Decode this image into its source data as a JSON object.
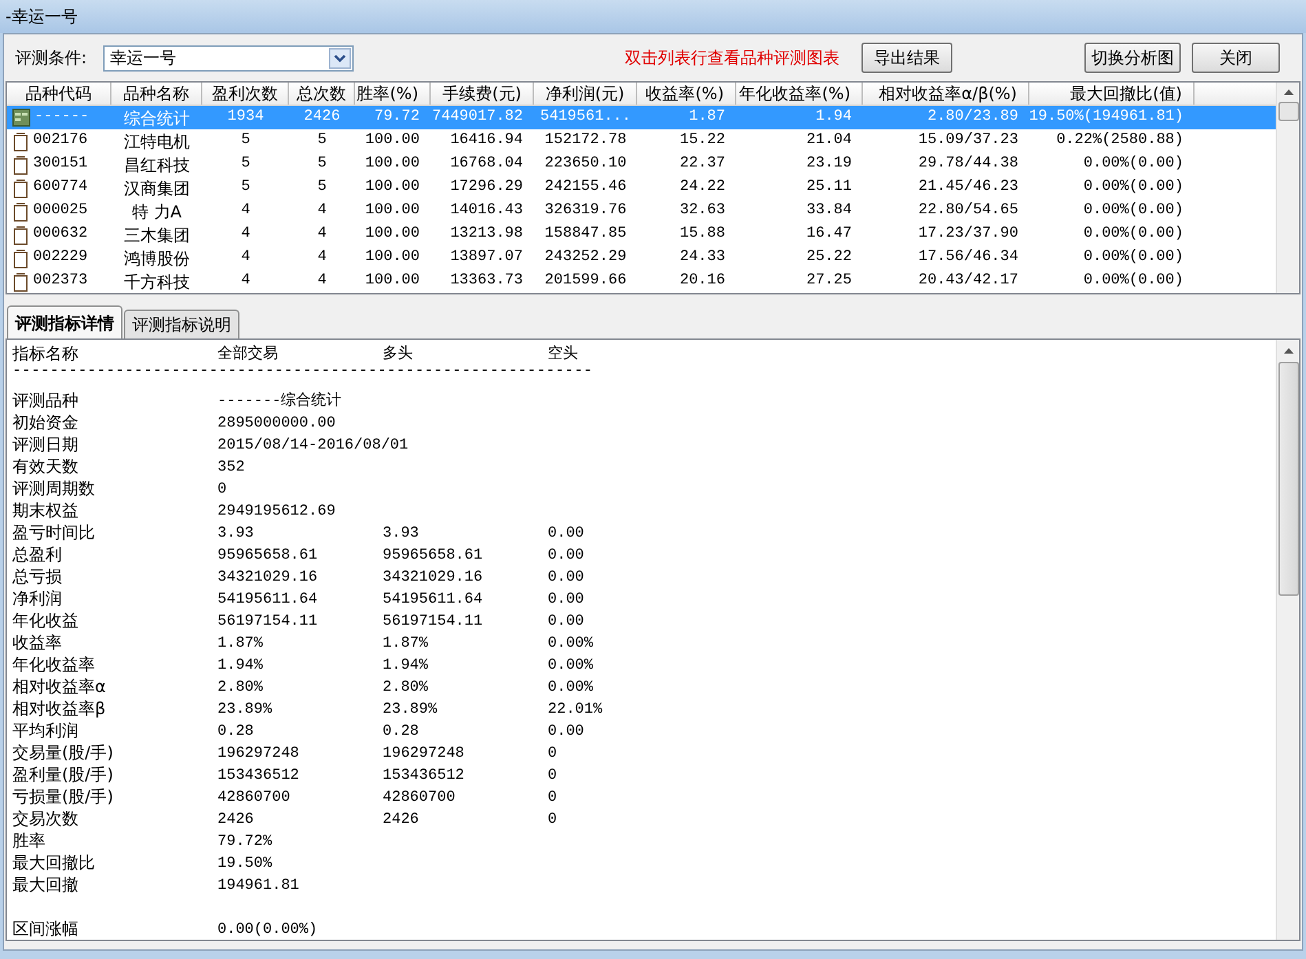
{
  "window": {
    "title": "-幸运一号"
  },
  "toolbar": {
    "condition_label": "评测条件:",
    "condition_value": "幸运一号",
    "hint": "双击列表行查看品种评测图表",
    "buttons": [
      "导出结果",
      "切换分析图",
      "关闭"
    ]
  },
  "table": {
    "columns": [
      "品种代码",
      "品种名称",
      "盈利次数",
      "总次数",
      "胜率(%)",
      "手续费(元)",
      "净利润(元)",
      "收益率(%)",
      "年化收益率(%)",
      "相对收益率α/β(%)",
      "最大回撤比(值)"
    ],
    "rows": [
      {
        "kind": "summary",
        "selected": true,
        "cells": [
          "------",
          "综合统计",
          "1934",
          "2426",
          "79.72",
          "7449017.82",
          "5419561...",
          "1.87",
          "1.94",
          "2.80/23.89",
          "19.50%(194961.81)"
        ]
      },
      {
        "kind": "stock",
        "selected": false,
        "cells": [
          "002176",
          "江特电机",
          "5",
          "5",
          "100.00",
          "16416.94",
          "152172.78",
          "15.22",
          "21.04",
          "15.09/37.23",
          "0.22%(2580.88)"
        ]
      },
      {
        "kind": "stock",
        "selected": false,
        "cells": [
          "300151",
          "昌红科技",
          "5",
          "5",
          "100.00",
          "16768.04",
          "223650.10",
          "22.37",
          "23.19",
          "29.78/44.38",
          "0.00%(0.00)"
        ]
      },
      {
        "kind": "stock",
        "selected": false,
        "cells": [
          "600774",
          "汉商集团",
          "5",
          "5",
          "100.00",
          "17296.29",
          "242155.46",
          "24.22",
          "25.11",
          "21.45/46.23",
          "0.00%(0.00)"
        ]
      },
      {
        "kind": "stock",
        "selected": false,
        "cells": [
          "000025",
          "特 力A",
          "4",
          "4",
          "100.00",
          "14016.43",
          "326319.76",
          "32.63",
          "33.84",
          "22.80/54.65",
          "0.00%(0.00)"
        ]
      },
      {
        "kind": "stock",
        "selected": false,
        "cells": [
          "000632",
          "三木集团",
          "4",
          "4",
          "100.00",
          "13213.98",
          "158847.85",
          "15.88",
          "16.47",
          "17.23/37.90",
          "0.00%(0.00)"
        ]
      },
      {
        "kind": "stock",
        "selected": false,
        "cells": [
          "002229",
          "鸿博股份",
          "4",
          "4",
          "100.00",
          "13897.07",
          "243252.29",
          "24.33",
          "25.22",
          "17.56/46.34",
          "0.00%(0.00)"
        ]
      },
      {
        "kind": "stock",
        "selected": false,
        "cells": [
          "002373",
          "千方科技",
          "4",
          "4",
          "100.00",
          "13363.73",
          "201599.66",
          "20.16",
          "27.25",
          "20.43/42.17",
          "0.00%(0.00)"
        ]
      }
    ]
  },
  "tabs": [
    {
      "label": "评测指标详情",
      "selected": true
    },
    {
      "label": "评测指标说明",
      "selected": false
    }
  ],
  "details": {
    "lines": [
      {
        "kind": "row",
        "cells": [
          "指标名称",
          "全部交易",
          "多头",
          "空头"
        ]
      },
      {
        "kind": "text",
        "text": "--------------------------------------------------------------"
      },
      {
        "kind": "row",
        "cells": [
          "评测品种",
          "-------综合统计"
        ]
      },
      {
        "kind": "row",
        "cells": [
          "初始资金",
          "2895000000.00"
        ]
      },
      {
        "kind": "row",
        "cells": [
          "评测日期",
          "2015/08/14-2016/08/01"
        ]
      },
      {
        "kind": "row",
        "cells": [
          "有效天数",
          "352"
        ]
      },
      {
        "kind": "row",
        "cells": [
          "评测周期数",
          "0"
        ]
      },
      {
        "kind": "row",
        "cells": [
          "期末权益",
          "2949195612.69"
        ]
      },
      {
        "kind": "row",
        "cells": [
          "盈亏时间比",
          "3.93",
          "3.93",
          "0.00"
        ]
      },
      {
        "kind": "row",
        "cells": [
          "总盈利",
          "95965658.61",
          "95965658.61",
          "0.00"
        ]
      },
      {
        "kind": "row",
        "cells": [
          "总亏损",
          "34321029.16",
          "34321029.16",
          "0.00"
        ]
      },
      {
        "kind": "row",
        "cells": [
          "净利润",
          "54195611.64",
          "54195611.64",
          "0.00"
        ]
      },
      {
        "kind": "row",
        "cells": [
          "年化收益",
          "56197154.11",
          "56197154.11",
          "0.00"
        ]
      },
      {
        "kind": "row",
        "cells": [
          "收益率",
          "1.87%",
          "1.87%",
          "0.00%"
        ]
      },
      {
        "kind": "row",
        "cells": [
          "年化收益率",
          "1.94%",
          "1.94%",
          "0.00%"
        ]
      },
      {
        "kind": "row",
        "cells": [
          "相对收益率α",
          "2.80%",
          "2.80%",
          "0.00%"
        ]
      },
      {
        "kind": "row",
        "cells": [
          "相对收益率β",
          "23.89%",
          "23.89%",
          "22.01%"
        ]
      },
      {
        "kind": "row",
        "cells": [
          "平均利润",
          "0.28",
          "0.28",
          "0.00"
        ]
      },
      {
        "kind": "row",
        "cells": [
          "交易量(股/手)",
          "196297248",
          "196297248",
          "0"
        ]
      },
      {
        "kind": "row",
        "cells": [
          "盈利量(股/手)",
          "153436512",
          "153436512",
          "0"
        ]
      },
      {
        "kind": "row",
        "cells": [
          "亏损量(股/手)",
          "42860700",
          "42860700",
          "0"
        ]
      },
      {
        "kind": "row",
        "cells": [
          "交易次数",
          "2426",
          "2426",
          "0"
        ]
      },
      {
        "kind": "row",
        "cells": [
          "胜率",
          "79.72%"
        ]
      },
      {
        "kind": "row",
        "cells": [
          "最大回撤比",
          "19.50%"
        ]
      },
      {
        "kind": "row",
        "cells": [
          "最大回撤",
          "194961.81"
        ]
      },
      {
        "kind": "spacer"
      },
      {
        "kind": "row",
        "cells": [
          "区间涨幅",
          "0.00(0.00%)"
        ]
      }
    ]
  }
}
